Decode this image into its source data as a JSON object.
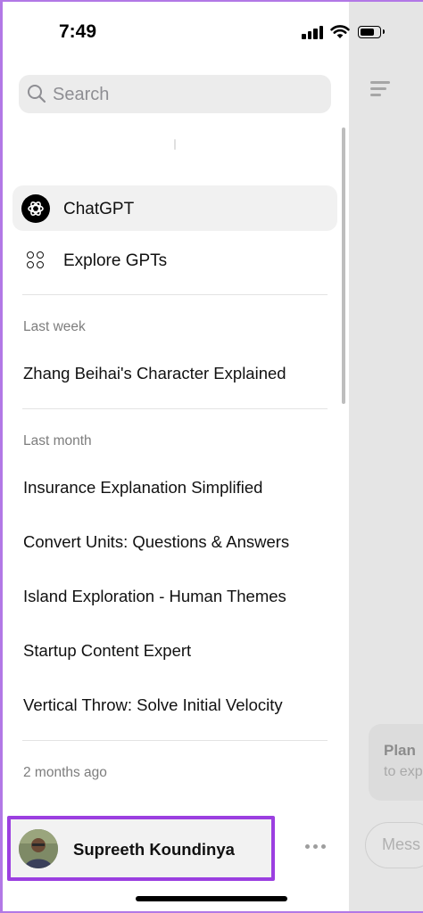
{
  "status_bar": {
    "time": "7:49"
  },
  "search": {
    "placeholder": "Search"
  },
  "nav": {
    "chatgpt_label": "ChatGPT",
    "explore_label": "Explore GPTs"
  },
  "sections": [
    {
      "label": "Last week",
      "items": [
        "Zhang Beihai's Character Explained"
      ]
    },
    {
      "label": "Last month",
      "items": [
        "Insurance Explanation Simplified",
        "Convert Units: Questions & Answers",
        "Island Exploration - Human Themes",
        "Startup Content Expert",
        "Vertical Throw: Solve Initial Velocity"
      ]
    },
    {
      "label": "2 months ago",
      "items": []
    }
  ],
  "profile": {
    "name": "Supreeth Koundinya"
  },
  "background_panel": {
    "plan_title": "Plan",
    "plan_subtitle": "to exp",
    "message_placeholder": "Mess"
  },
  "colors": {
    "highlight_border": "#9b3fe0",
    "frame_border": "#b278e6",
    "dim_panel": "#e5e5e5"
  }
}
